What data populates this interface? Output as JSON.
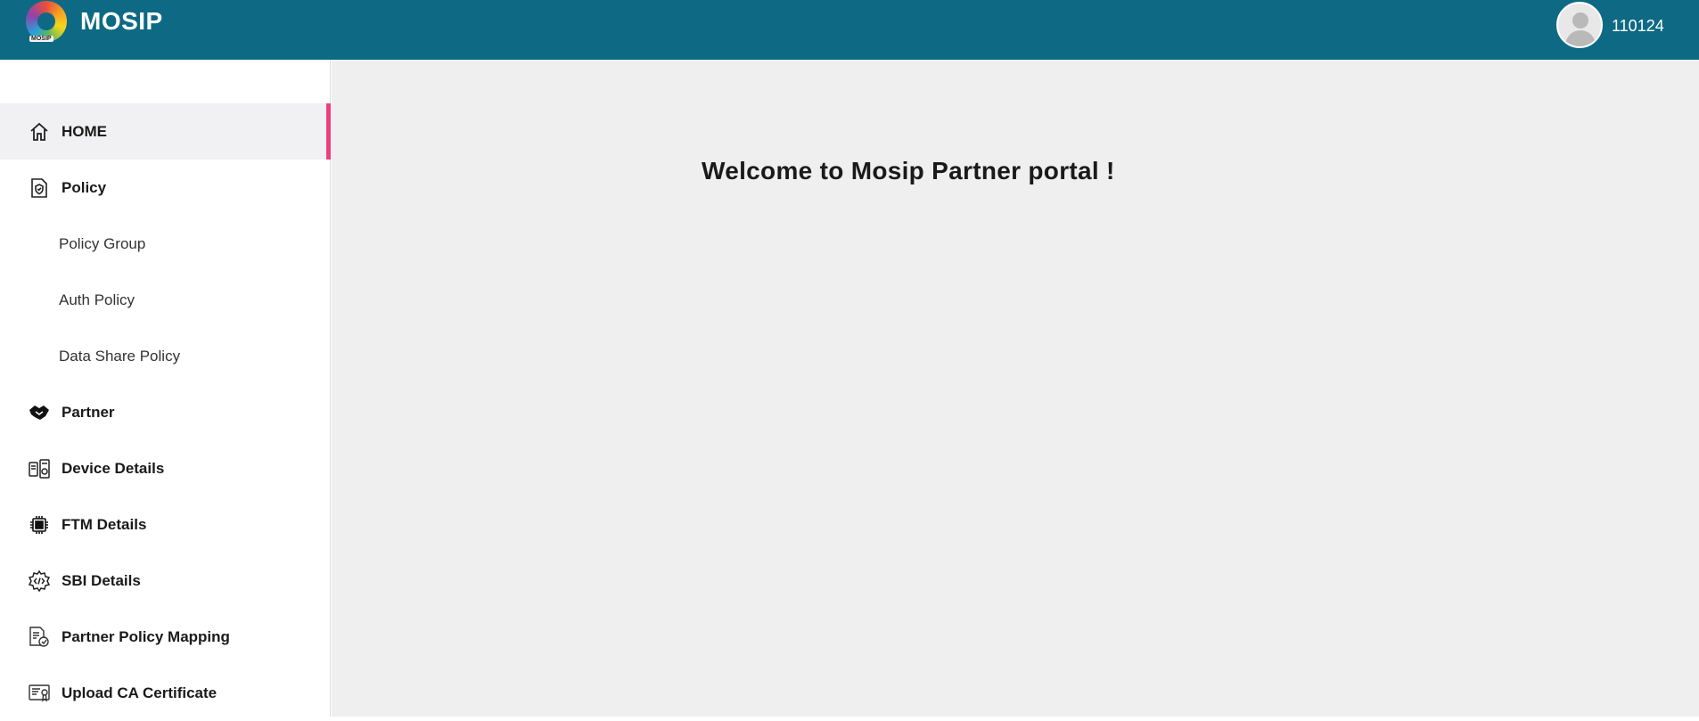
{
  "header": {
    "app_title": "MOSIP",
    "logo_text": "MOSIP",
    "username": "110124",
    "bg_color": "#0e6a84"
  },
  "sidebar": {
    "items": [
      {
        "label": "HOME",
        "icon": "home-icon",
        "active": true
      },
      {
        "label": "Policy",
        "icon": "policy-document-icon"
      },
      {
        "label": "Policy Group",
        "sub": true
      },
      {
        "label": "Auth Policy",
        "sub": true
      },
      {
        "label": "Data Share Policy",
        "sub": true
      },
      {
        "label": "Partner",
        "icon": "handshake-icon"
      },
      {
        "label": "Device Details",
        "icon": "devices-icon"
      },
      {
        "label": "FTM Details",
        "icon": "chip-icon"
      },
      {
        "label": "SBI Details",
        "icon": "gear-code-icon"
      },
      {
        "label": "Partner Policy Mapping",
        "icon": "mapping-document-icon"
      },
      {
        "label": "Upload CA Certificate",
        "icon": "certificate-icon"
      }
    ],
    "active_color": "#ee3e7d"
  },
  "main": {
    "welcome": "Welcome to Mosip Partner portal !"
  }
}
